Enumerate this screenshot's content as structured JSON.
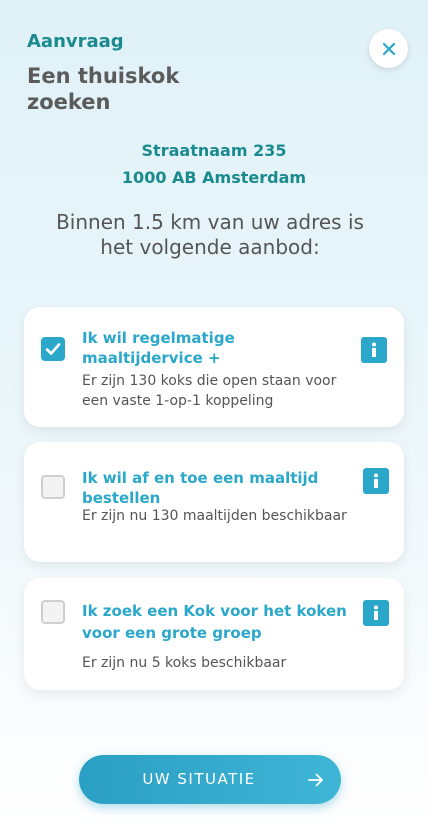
{
  "header": {
    "label": "Aanvraag",
    "title": "Een thuiskok zoeken",
    "close_icon": "close-icon"
  },
  "address": {
    "line1": "Straatnaam 235",
    "line2": "1000 AB Amsterdam"
  },
  "intro": "Binnen 1.5 km van uw adres is het volgende aanbod:",
  "options": [
    {
      "checked": true,
      "title": "Ik wil regelmatige maaltijdervice +",
      "description": "Er zijn 130 koks die open staan voor een vaste 1-op-1 koppeling",
      "icon": "info-icon"
    },
    {
      "checked": false,
      "title": "Ik wil af en toe een maaltijd bestellen",
      "description": "Er zijn nu 130 maaltijden beschikbaar",
      "icon": "info-icon"
    },
    {
      "checked": false,
      "title": "Ik zoek een Kok voor het koken voor een grote groep",
      "description": "Er zijn nu 5 koks beschikbaar",
      "icon": "info-icon"
    }
  ],
  "cta": {
    "label": "UW SITUATIE",
    "icon": "arrow-right-icon"
  },
  "colors": {
    "accent": "#2aa7c9",
    "teal": "#1a8a8e",
    "title_gray": "#5b5b5b"
  }
}
